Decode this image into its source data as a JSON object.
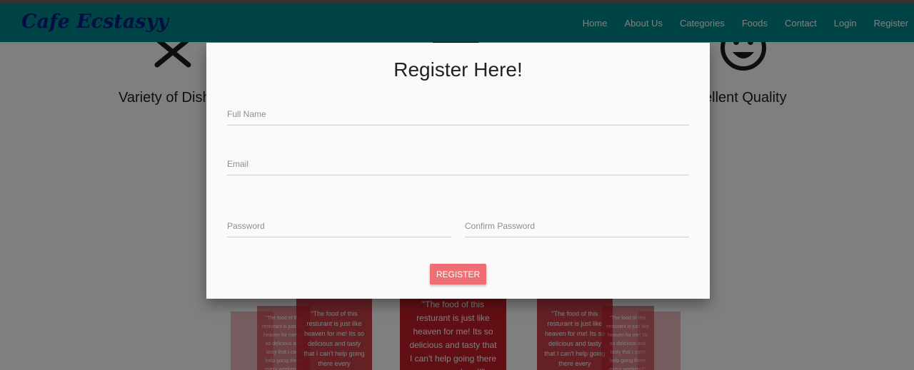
{
  "brand": "Cafe Ecstasyy",
  "nav": {
    "items": [
      "Home",
      "About Us",
      "Categories",
      "Foods",
      "Contact",
      "Login",
      "Register"
    ]
  },
  "features": {
    "left_label": "Variety of Dish",
    "right_label": "ellent Quality",
    "left_icon": "cutlery-icon",
    "right_icon": "smiley-icon"
  },
  "testimonial": {
    "text": "\"The food of this resturant is just like heaven for me! Its so delicious and tasty that I can't help going there every weekend!\""
  },
  "modal": {
    "title": "Register Here!",
    "full_name_placeholder": "Full Name",
    "email_placeholder": "Email",
    "password_placeholder": "Password",
    "confirm_password_placeholder": "Confirm Password",
    "register_label": "REGISTER"
  },
  "colors": {
    "navbar": "#00898a",
    "brand": "#0a1a8a",
    "register_button": "#ee6e73",
    "testimonial_card": "#c21f29"
  }
}
